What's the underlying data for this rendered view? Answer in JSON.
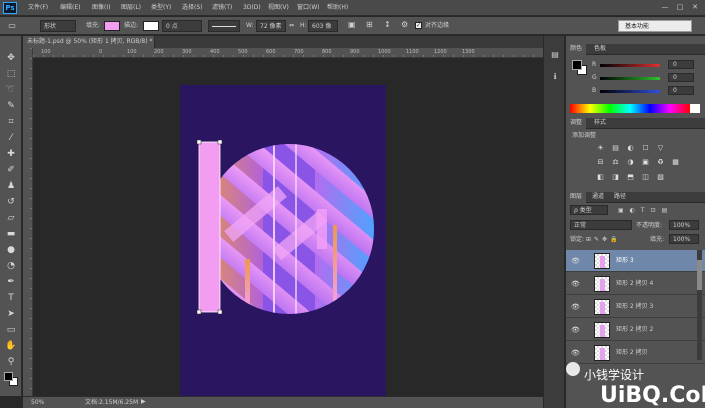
{
  "menubar": {
    "logo": "Ps",
    "items": [
      "文件(F)",
      "编辑(E)",
      "图像(I)",
      "图层(L)",
      "类型(Y)",
      "选择(S)",
      "滤镜(T)",
      "3D(D)",
      "视图(V)",
      "窗口(W)",
      "帮助(H)"
    ],
    "window_controls": [
      "—",
      "□",
      "✕"
    ]
  },
  "options": {
    "shape_mode": "形状",
    "fill_label": "填充:",
    "fill_color": "#f29cf2",
    "stroke_label": "描边:",
    "stroke_width": "0 点",
    "w_label": "W:",
    "w_value": "72 像素",
    "h_label": "H:",
    "h_value": "603 像",
    "align_edges": "对齐边缘",
    "workspace": "基本功能"
  },
  "document": {
    "tab_title": "未标题-1.psd @ 50% (矩形 1 拷贝, RGB/8) *",
    "ruler_numbers": [
      "100",
      "0",
      "100",
      "200",
      "300",
      "400",
      "500",
      "600",
      "700",
      "800",
      "900",
      "1000",
      "1100",
      "1200",
      "1300"
    ],
    "zoom": "50%",
    "doc_size": "文档:2.15M/6.25M"
  },
  "color_panel": {
    "tabs": [
      "颜色",
      "色板"
    ],
    "channels": [
      {
        "label": "R",
        "value": "0",
        "color": "#e03030"
      },
      {
        "label": "G",
        "value": "0",
        "color": "#30c030"
      },
      {
        "label": "B",
        "value": "0",
        "color": "#3050e0"
      }
    ]
  },
  "adjust_panel": {
    "tabs": [
      "调整",
      "样式"
    ],
    "title": "添加调整",
    "icons": [
      "☀",
      "▤",
      "◐",
      "☐",
      "▽",
      "⊟",
      "⚖",
      "◑",
      "▣",
      "♻",
      "▦",
      "◧",
      "◨",
      "⬒",
      "◫",
      "▧"
    ]
  },
  "layers_panel": {
    "tabs": [
      "图层",
      "通道",
      "路径"
    ],
    "filter": "ρ 类型",
    "blend_mode": "正常",
    "opacity_label": "不透明度:",
    "opacity": "100%",
    "lock_label": "锁定:",
    "fill_label": "填充:",
    "fill": "100%",
    "layers": [
      {
        "name": "矩形 3",
        "selected": true
      },
      {
        "name": "矩形 2 拷贝 4",
        "selected": false
      },
      {
        "name": "矩形 2 拷贝 3",
        "selected": false
      },
      {
        "name": "矩形 2 拷贝 2",
        "selected": false
      },
      {
        "name": "矩形 2 拷贝",
        "selected": false
      }
    ]
  },
  "watermark": {
    "text1": "小钱学设计",
    "text2": "UiBQ.CoM"
  },
  "artwork_colors": {
    "background": "#2a1560",
    "pink": "#f4a0f7",
    "purple": "#8a55e6",
    "blue": "#4aa8ff",
    "orange": "#f0984a"
  }
}
